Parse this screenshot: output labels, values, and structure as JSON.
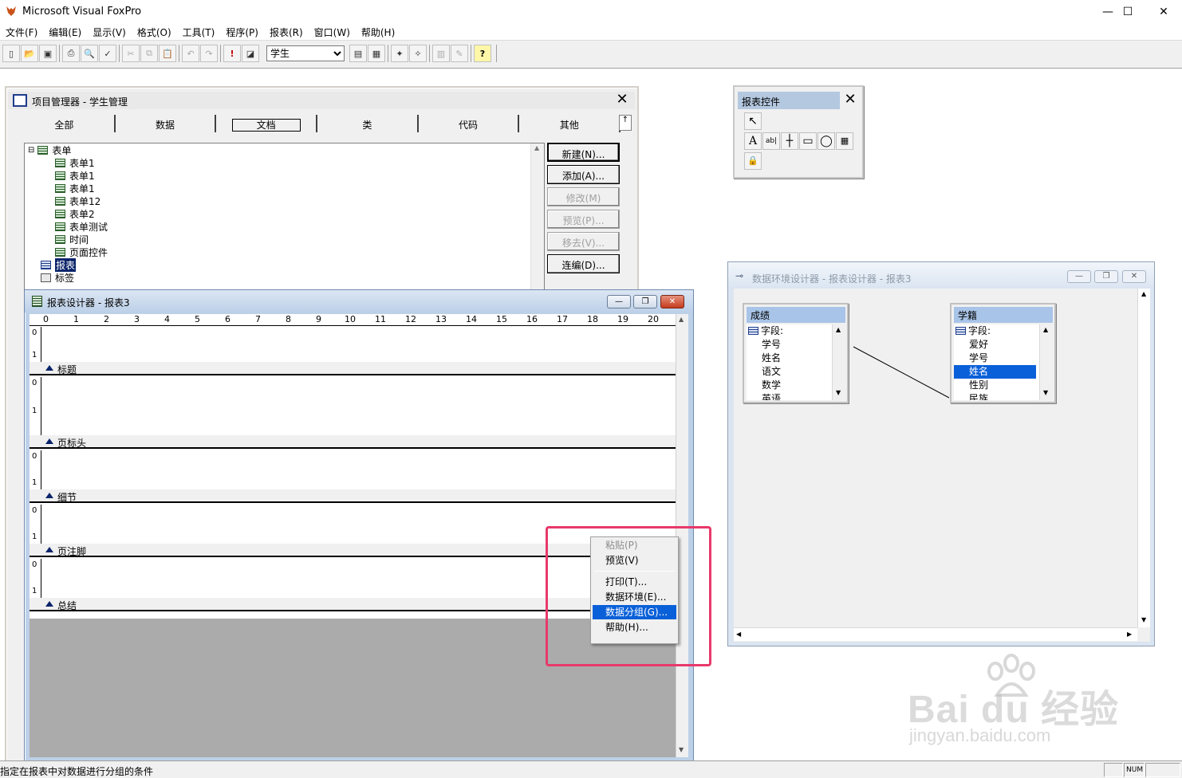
{
  "app": {
    "title": "Microsoft Visual FoxPro"
  },
  "window_controls": {
    "minimize": "—",
    "maximize": "☐",
    "close": "✕"
  },
  "menu": [
    "文件(F)",
    "编辑(E)",
    "显示(V)",
    "格式(O)",
    "工具(T)",
    "程序(P)",
    "报表(R)",
    "窗口(W)",
    "帮助(H)"
  ],
  "toolbar": {
    "database_combo_value": "学生"
  },
  "project_manager": {
    "title": "项目管理器 - 学生管理",
    "tabs": [
      "全部",
      "数据",
      "文档",
      "类",
      "代码",
      "其他"
    ],
    "active_tab": "文档",
    "tree": {
      "forms_group": "表单",
      "forms": [
        "表单1",
        "表单1",
        "表单1",
        "表单12",
        "表单2",
        "表单测试",
        "时间",
        "页面控件"
      ],
      "reports_group": "报表",
      "labels_group": "标签"
    },
    "buttons": {
      "new": "新建(N)...",
      "add": "添加(A)...",
      "modify": "修改(M)",
      "preview": "预览(P)...",
      "remove": "移去(V)...",
      "build": "连编(D)..."
    }
  },
  "report_designer": {
    "title": "报表设计器 - 报表3",
    "ruler_numbers": [
      "0",
      "1",
      "2",
      "3",
      "4",
      "5",
      "6",
      "7",
      "8",
      "9",
      "10",
      "11",
      "12",
      "13",
      "14",
      "15",
      "16",
      "17",
      "18",
      "19",
      "20"
    ],
    "vruler": {
      "zero": "0",
      "one": "1"
    },
    "bands": [
      "标题",
      "页标头",
      "细节",
      "页注脚",
      "总结"
    ]
  },
  "context_menu": {
    "items": [
      {
        "label": "粘贴(P)",
        "enabled": false
      },
      {
        "label": "预览(V)",
        "enabled": true
      },
      {
        "label": "打印(T)...",
        "enabled": true
      },
      {
        "label": "数据环境(E)...",
        "enabled": true
      },
      {
        "label": "数据分组(G)...",
        "enabled": true,
        "highlighted": true
      },
      {
        "label": "帮助(H)...",
        "enabled": true
      }
    ]
  },
  "report_controls": {
    "title": "报表控件",
    "close": "✕"
  },
  "data_environment": {
    "title": "数据环境设计器 - 报表设计器 - 报表3",
    "tables": [
      {
        "name": "成绩",
        "header": "字段:",
        "fields": [
          "学号",
          "姓名",
          "语文",
          "数学",
          "英语"
        ]
      },
      {
        "name": "学籍",
        "header": "字段:",
        "fields": [
          "爱好",
          "学号",
          "姓名",
          "性别",
          "民族"
        ],
        "selected": "姓名"
      }
    ]
  },
  "status_bar": {
    "text": "指定在报表中对数据进行分组的条件",
    "num": "NUM"
  },
  "watermark": {
    "main": "Bai du 经验",
    "sub": "jingyan.baidu.com"
  },
  "colors": {
    "highlight_box": "#e8396a",
    "selection": "#0a60d8"
  }
}
